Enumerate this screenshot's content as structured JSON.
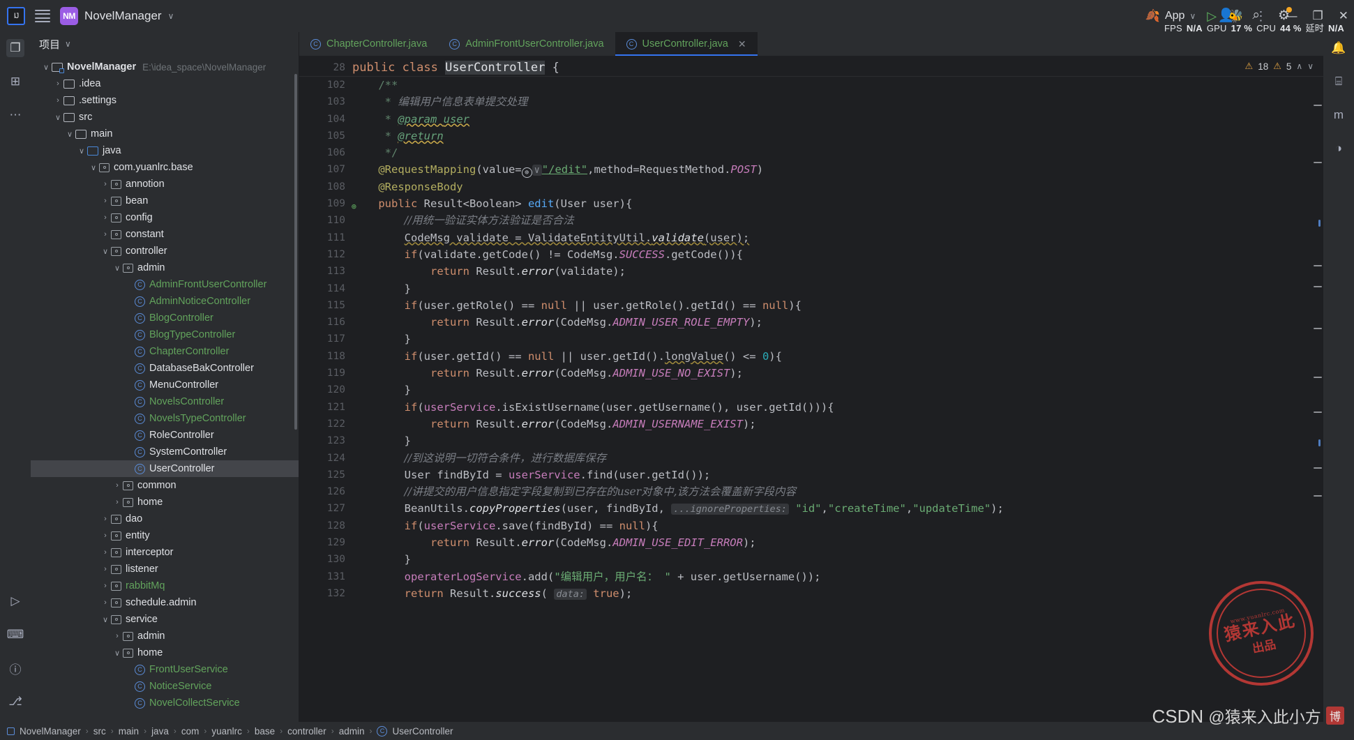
{
  "titlebar": {
    "ide_logo": "IJ",
    "menu_icon": "hamburger-icon",
    "project_badge": "NM",
    "project_name": "NovelManager",
    "chevron": "∨",
    "run_config": "App",
    "run_icon": "▷",
    "debug_icon": "🐞",
    "more_icon": "⋮",
    "account_icon": "👤",
    "search_icon": "⌕",
    "settings_icon": "⚙",
    "minimize": "—",
    "maximize": "❐",
    "close": "✕",
    "perf": {
      "fps_label": "FPS",
      "fps_value": "N/A",
      "gpu_label": "GPU",
      "gpu_value": "17 %",
      "cpu_label": "CPU",
      "cpu_value": "44 %",
      "latency_label": "延时",
      "latency_value": "N/A"
    }
  },
  "left_stripe": {
    "items": [
      {
        "name": "project-tool-icon",
        "glyph": "❐"
      },
      {
        "name": "commit-tool-icon",
        "glyph": "⊞"
      },
      {
        "name": "more-tool-icon",
        "glyph": "⋯"
      }
    ],
    "bottom": [
      {
        "name": "run-tool-icon",
        "glyph": "▷"
      },
      {
        "name": "terminal-tool-icon",
        "glyph": "⌨"
      },
      {
        "name": "problems-tool-icon",
        "glyph": "ⓘ"
      },
      {
        "name": "git-tool-icon",
        "glyph": "⎇"
      }
    ]
  },
  "right_stripe": {
    "items": [
      {
        "name": "notifications-icon",
        "glyph": "🔔"
      },
      {
        "name": "database-icon",
        "glyph": "⌸"
      },
      {
        "name": "maven-icon",
        "glyph": "m"
      },
      {
        "name": "spring-icon",
        "glyph": "◑"
      }
    ]
  },
  "project_panel": {
    "title": "项目",
    "title_chevron": "∨",
    "tree": [
      {
        "depth": 0,
        "twisty": "∨",
        "icon": "module-icon",
        "label": "NovelManager",
        "bold": true,
        "path": "E:\\idea_space\\NovelManager"
      },
      {
        "depth": 1,
        "twisty": "›",
        "icon": "folder-icon",
        "label": ".idea"
      },
      {
        "depth": 1,
        "twisty": "›",
        "icon": "folder-icon",
        "label": ".settings"
      },
      {
        "depth": 1,
        "twisty": "∨",
        "icon": "folder-icon",
        "label": "src"
      },
      {
        "depth": 2,
        "twisty": "∨",
        "icon": "folder-icon",
        "label": "main"
      },
      {
        "depth": 3,
        "twisty": "∨",
        "icon": "source-folder-icon",
        "label": "java"
      },
      {
        "depth": 4,
        "twisty": "∨",
        "icon": "package-icon",
        "label": "com.yuanlrc.base"
      },
      {
        "depth": 5,
        "twisty": "›",
        "icon": "package-icon",
        "label": "annotion"
      },
      {
        "depth": 5,
        "twisty": "›",
        "icon": "package-icon",
        "label": "bean"
      },
      {
        "depth": 5,
        "twisty": "›",
        "icon": "package-icon",
        "label": "config"
      },
      {
        "depth": 5,
        "twisty": "›",
        "icon": "package-icon",
        "label": "constant"
      },
      {
        "depth": 5,
        "twisty": "∨",
        "icon": "package-icon",
        "label": "controller"
      },
      {
        "depth": 6,
        "twisty": "∨",
        "icon": "package-icon",
        "label": "admin"
      },
      {
        "depth": 7,
        "twisty": "",
        "icon": "class-icon",
        "label": "AdminFrontUserController",
        "green": true
      },
      {
        "depth": 7,
        "twisty": "",
        "icon": "class-icon",
        "label": "AdminNoticeController",
        "green": true
      },
      {
        "depth": 7,
        "twisty": "",
        "icon": "class-icon",
        "label": "BlogController",
        "green": true
      },
      {
        "depth": 7,
        "twisty": "",
        "icon": "class-icon",
        "label": "BlogTypeController",
        "green": true
      },
      {
        "depth": 7,
        "twisty": "",
        "icon": "class-icon",
        "label": "ChapterController",
        "green": true
      },
      {
        "depth": 7,
        "twisty": "",
        "icon": "class-icon",
        "label": "DatabaseBakController"
      },
      {
        "depth": 7,
        "twisty": "",
        "icon": "class-icon",
        "label": "MenuController"
      },
      {
        "depth": 7,
        "twisty": "",
        "icon": "class-icon",
        "label": "NovelsController",
        "green": true
      },
      {
        "depth": 7,
        "twisty": "",
        "icon": "class-icon",
        "label": "NovelsTypeController",
        "green": true
      },
      {
        "depth": 7,
        "twisty": "",
        "icon": "class-icon",
        "label": "RoleController"
      },
      {
        "depth": 7,
        "twisty": "",
        "icon": "class-icon",
        "label": "SystemController"
      },
      {
        "depth": 7,
        "twisty": "",
        "icon": "class-icon",
        "label": "UserController",
        "selected": true
      },
      {
        "depth": 6,
        "twisty": "›",
        "icon": "package-icon",
        "label": "common"
      },
      {
        "depth": 6,
        "twisty": "›",
        "icon": "package-icon",
        "label": "home"
      },
      {
        "depth": 5,
        "twisty": "›",
        "icon": "package-icon",
        "label": "dao"
      },
      {
        "depth": 5,
        "twisty": "›",
        "icon": "package-icon",
        "label": "entity"
      },
      {
        "depth": 5,
        "twisty": "›",
        "icon": "package-icon",
        "label": "interceptor"
      },
      {
        "depth": 5,
        "twisty": "›",
        "icon": "package-icon",
        "label": "listener"
      },
      {
        "depth": 5,
        "twisty": "›",
        "icon": "package-icon",
        "label": "rabbitMq",
        "green": true
      },
      {
        "depth": 5,
        "twisty": "›",
        "icon": "package-icon",
        "label": "schedule.admin"
      },
      {
        "depth": 5,
        "twisty": "∨",
        "icon": "package-icon",
        "label": "service"
      },
      {
        "depth": 6,
        "twisty": "›",
        "icon": "package-icon",
        "label": "admin"
      },
      {
        "depth": 6,
        "twisty": "∨",
        "icon": "package-icon",
        "label": "home"
      },
      {
        "depth": 7,
        "twisty": "",
        "icon": "class-icon",
        "label": "FrontUserService",
        "green": true
      },
      {
        "depth": 7,
        "twisty": "",
        "icon": "class-icon",
        "label": "NoticeService",
        "green": true
      },
      {
        "depth": 7,
        "twisty": "",
        "icon": "class-icon",
        "label": "NovelCollectService",
        "green": true
      }
    ]
  },
  "tabs": [
    {
      "label": "ChapterController.java",
      "active": false,
      "closable": false
    },
    {
      "label": "AdminFrontUserController.java",
      "active": false,
      "closable": false
    },
    {
      "label": "UserController.java",
      "active": true,
      "closable": true
    }
  ],
  "sticky_line": {
    "number": "28",
    "segments": [
      {
        "t": "public ",
        "c": "kw"
      },
      {
        "t": "class ",
        "c": "kw"
      },
      {
        "t": "UserController",
        "c": "cls selbg"
      },
      {
        "t": " {",
        "c": "pln"
      }
    ]
  },
  "inspections": {
    "warning_icon": "⚠",
    "warning_count": "18",
    "weak_warning_icon": "⚠",
    "weak_warning_count": "5",
    "prev_icon": "∧",
    "next_icon": "∨"
  },
  "code_lines": [
    {
      "n": "102",
      "segs": [
        {
          "t": "    ",
          "c": "pln"
        },
        {
          "t": "/**",
          "c": "jdoc"
        }
      ]
    },
    {
      "n": "103",
      "segs": [
        {
          "t": "     ",
          "c": "pln"
        },
        {
          "t": "* ",
          "c": "jdoc"
        },
        {
          "t": "编辑用户信息表单提交处理",
          "c": "jdoc-txt"
        }
      ]
    },
    {
      "n": "104",
      "segs": [
        {
          "t": "     ",
          "c": "pln"
        },
        {
          "t": "* ",
          "c": "jdoc"
        },
        {
          "t": "@param ",
          "c": "tag"
        },
        {
          "t": "user",
          "c": "tag"
        }
      ]
    },
    {
      "n": "105",
      "segs": [
        {
          "t": "     ",
          "c": "pln"
        },
        {
          "t": "* ",
          "c": "jdoc"
        },
        {
          "t": "@return",
          "c": "tag"
        }
      ]
    },
    {
      "n": "106",
      "segs": [
        {
          "t": "     ",
          "c": "pln"
        },
        {
          "t": "*/",
          "c": "jdoc"
        }
      ]
    },
    {
      "n": "107",
      "segs": [
        {
          "t": "    ",
          "c": "pln"
        },
        {
          "t": "@RequestMapping",
          "c": "ann"
        },
        {
          "t": "(value=",
          "c": "pln"
        },
        {
          "t": "GLOBE",
          "c": "globe-chip"
        },
        {
          "t": "\"/edit\"",
          "c": "str ulink"
        },
        {
          "t": ",method=RequestMethod.",
          "c": "pln"
        },
        {
          "t": "POST",
          "c": "fld"
        },
        {
          "t": ")",
          "c": "pln"
        }
      ]
    },
    {
      "n": "108",
      "segs": [
        {
          "t": "    ",
          "c": "pln"
        },
        {
          "t": "@ResponseBody",
          "c": "ann"
        }
      ]
    },
    {
      "n": "109",
      "gutter_mark": "Ⓓ",
      "segs": [
        {
          "t": "    ",
          "c": "pln"
        },
        {
          "t": "public ",
          "c": "kw"
        },
        {
          "t": "Result<Boolean> ",
          "c": "pln"
        },
        {
          "t": "edit",
          "c": "mth"
        },
        {
          "t": "(User user){",
          "c": "pln"
        }
      ]
    },
    {
      "n": "110",
      "segs": [
        {
          "t": "        ",
          "c": "pln"
        },
        {
          "t": "//用统一验证实体方法验证是否合法",
          "c": "cmt"
        }
      ]
    },
    {
      "n": "111",
      "segs": [
        {
          "t": "        ",
          "c": "pln"
        },
        {
          "t": "CodeMsg validate = ValidateEntityUtil.",
          "c": "pln wavy"
        },
        {
          "t": "validate",
          "c": "mthi wavy"
        },
        {
          "t": "(user);",
          "c": "pln wavy"
        }
      ]
    },
    {
      "n": "112",
      "segs": [
        {
          "t": "        ",
          "c": "pln"
        },
        {
          "t": "if",
          "c": "kw"
        },
        {
          "t": "(validate.getCode() != CodeMsg.",
          "c": "pln"
        },
        {
          "t": "SUCCESS",
          "c": "fld"
        },
        {
          "t": ".getCode()){",
          "c": "pln"
        }
      ]
    },
    {
      "n": "113",
      "segs": [
        {
          "t": "            ",
          "c": "pln"
        },
        {
          "t": "return ",
          "c": "kw"
        },
        {
          "t": "Result.",
          "c": "pln"
        },
        {
          "t": "error",
          "c": "mthi"
        },
        {
          "t": "(validate);",
          "c": "pln"
        }
      ]
    },
    {
      "n": "114",
      "segs": [
        {
          "t": "        }",
          "c": "pln"
        }
      ]
    },
    {
      "n": "115",
      "segs": [
        {
          "t": "        ",
          "c": "pln"
        },
        {
          "t": "if",
          "c": "kw"
        },
        {
          "t": "(user.getRole() == ",
          "c": "pln"
        },
        {
          "t": "null",
          "c": "kw"
        },
        {
          "t": " || user.getRole().getId() == ",
          "c": "pln"
        },
        {
          "t": "null",
          "c": "kw"
        },
        {
          "t": "){",
          "c": "pln"
        }
      ]
    },
    {
      "n": "116",
      "segs": [
        {
          "t": "            ",
          "c": "pln"
        },
        {
          "t": "return ",
          "c": "kw"
        },
        {
          "t": "Result.",
          "c": "pln"
        },
        {
          "t": "error",
          "c": "mthi"
        },
        {
          "t": "(CodeMsg.",
          "c": "pln"
        },
        {
          "t": "ADMIN_USER_ROLE_EMPTY",
          "c": "fld"
        },
        {
          "t": ");",
          "c": "pln"
        }
      ]
    },
    {
      "n": "117",
      "segs": [
        {
          "t": "        }",
          "c": "pln"
        }
      ]
    },
    {
      "n": "118",
      "segs": [
        {
          "t": "        ",
          "c": "pln"
        },
        {
          "t": "if",
          "c": "kw"
        },
        {
          "t": "(user.getId() == ",
          "c": "pln"
        },
        {
          "t": "null",
          "c": "kw"
        },
        {
          "t": " || user.getId().",
          "c": "pln"
        },
        {
          "t": "longValue",
          "c": "pln wavy"
        },
        {
          "t": "() <= ",
          "c": "pln"
        },
        {
          "t": "0",
          "c": "num"
        },
        {
          "t": "){",
          "c": "pln"
        }
      ]
    },
    {
      "n": "119",
      "segs": [
        {
          "t": "            ",
          "c": "pln"
        },
        {
          "t": "return ",
          "c": "kw"
        },
        {
          "t": "Result.",
          "c": "pln"
        },
        {
          "t": "error",
          "c": "mthi"
        },
        {
          "t": "(CodeMsg.",
          "c": "pln"
        },
        {
          "t": "ADMIN_USE_NO_EXIST",
          "c": "fld"
        },
        {
          "t": ");",
          "c": "pln"
        }
      ]
    },
    {
      "n": "120",
      "segs": [
        {
          "t": "        }",
          "c": "pln"
        }
      ]
    },
    {
      "n": "121",
      "segs": [
        {
          "t": "        ",
          "c": "pln"
        },
        {
          "t": "if",
          "c": "kw"
        },
        {
          "t": "(",
          "c": "pln"
        },
        {
          "t": "userService",
          "c": "pink"
        },
        {
          "t": ".isExistUsername(user.getUsername(), user.getId())){",
          "c": "pln"
        }
      ]
    },
    {
      "n": "122",
      "segs": [
        {
          "t": "            ",
          "c": "pln"
        },
        {
          "t": "return ",
          "c": "kw"
        },
        {
          "t": "Result.",
          "c": "pln"
        },
        {
          "t": "error",
          "c": "mthi"
        },
        {
          "t": "(CodeMsg.",
          "c": "pln"
        },
        {
          "t": "ADMIN_USERNAME_EXIST",
          "c": "fld"
        },
        {
          "t": ");",
          "c": "pln"
        }
      ]
    },
    {
      "n": "123",
      "segs": [
        {
          "t": "        }",
          "c": "pln"
        }
      ]
    },
    {
      "n": "124",
      "segs": [
        {
          "t": "        ",
          "c": "pln"
        },
        {
          "t": "//到这说明一切符合条件，进行数据库保存",
          "c": "cmt"
        }
      ]
    },
    {
      "n": "125",
      "segs": [
        {
          "t": "        ",
          "c": "pln"
        },
        {
          "t": "User findById = ",
          "c": "pln"
        },
        {
          "t": "userService",
          "c": "pink"
        },
        {
          "t": ".find(user.getId());",
          "c": "pln"
        }
      ]
    },
    {
      "n": "126",
      "segs": [
        {
          "t": "        ",
          "c": "pln"
        },
        {
          "t": "//讲提交的用户信息指定字段复制到已存在的user对象中,该方法会覆盖新字段内容",
          "c": "cmt"
        }
      ]
    },
    {
      "n": "127",
      "segs": [
        {
          "t": "        ",
          "c": "pln"
        },
        {
          "t": "BeanUtils.",
          "c": "pln"
        },
        {
          "t": "copyProperties",
          "c": "mthi"
        },
        {
          "t": "(user, findById, ",
          "c": "pln"
        },
        {
          "t": "...ignoreProperties:",
          "c": "hint-chip"
        },
        {
          "t": " ",
          "c": "pln"
        },
        {
          "t": "\"id\"",
          "c": "str"
        },
        {
          "t": ",",
          "c": "pln"
        },
        {
          "t": "\"createTime\"",
          "c": "str"
        },
        {
          "t": ",",
          "c": "pln"
        },
        {
          "t": "\"updateTime\"",
          "c": "str"
        },
        {
          "t": ");",
          "c": "pln"
        }
      ]
    },
    {
      "n": "128",
      "segs": [
        {
          "t": "        ",
          "c": "pln"
        },
        {
          "t": "if",
          "c": "kw"
        },
        {
          "t": "(",
          "c": "pln"
        },
        {
          "t": "userService",
          "c": "pink"
        },
        {
          "t": ".save(findById) == ",
          "c": "pln"
        },
        {
          "t": "null",
          "c": "kw"
        },
        {
          "t": "){",
          "c": "pln"
        }
      ]
    },
    {
      "n": "129",
      "segs": [
        {
          "t": "            ",
          "c": "pln"
        },
        {
          "t": "return ",
          "c": "kw"
        },
        {
          "t": "Result.",
          "c": "pln"
        },
        {
          "t": "error",
          "c": "mthi"
        },
        {
          "t": "(CodeMsg.",
          "c": "pln"
        },
        {
          "t": "ADMIN_USE_EDIT_ERROR",
          "c": "fld"
        },
        {
          "t": ");",
          "c": "pln"
        }
      ]
    },
    {
      "n": "130",
      "segs": [
        {
          "t": "        }",
          "c": "pln"
        }
      ]
    },
    {
      "n": "131",
      "segs": [
        {
          "t": "        ",
          "c": "pln"
        },
        {
          "t": "operaterLogService",
          "c": "pink"
        },
        {
          "t": ".add(",
          "c": "pln"
        },
        {
          "t": "\"编辑用户，用户名： \"",
          "c": "str"
        },
        {
          "t": " + user.getUsername());",
          "c": "pln"
        }
      ]
    },
    {
      "n": "132",
      "segs": [
        {
          "t": "        ",
          "c": "pln"
        },
        {
          "t": "return ",
          "c": "kw"
        },
        {
          "t": "Result.",
          "c": "pln"
        },
        {
          "t": "success",
          "c": "mthi"
        },
        {
          "t": "( ",
          "c": "pln"
        },
        {
          "t": "data:",
          "c": "hint-chip"
        },
        {
          "t": " ",
          "c": "pln"
        },
        {
          "t": "true",
          "c": "kw"
        },
        {
          "t": ");",
          "c": "pln"
        }
      ]
    }
  ],
  "breadcrumb": {
    "separator": "›",
    "items": [
      "NovelManager",
      "src",
      "main",
      "java",
      "com",
      "yuanlrc",
      "base",
      "controller",
      "admin",
      "UserController"
    ]
  },
  "watermarks": {
    "stamp_top": "www.yuanlrc.com",
    "stamp_mid": "猿来入此",
    "stamp_bot": "出品",
    "csdn_prefix": "CSDN",
    "csdn_handle": "@猿来入此小方",
    "csdn_badge": "博"
  }
}
